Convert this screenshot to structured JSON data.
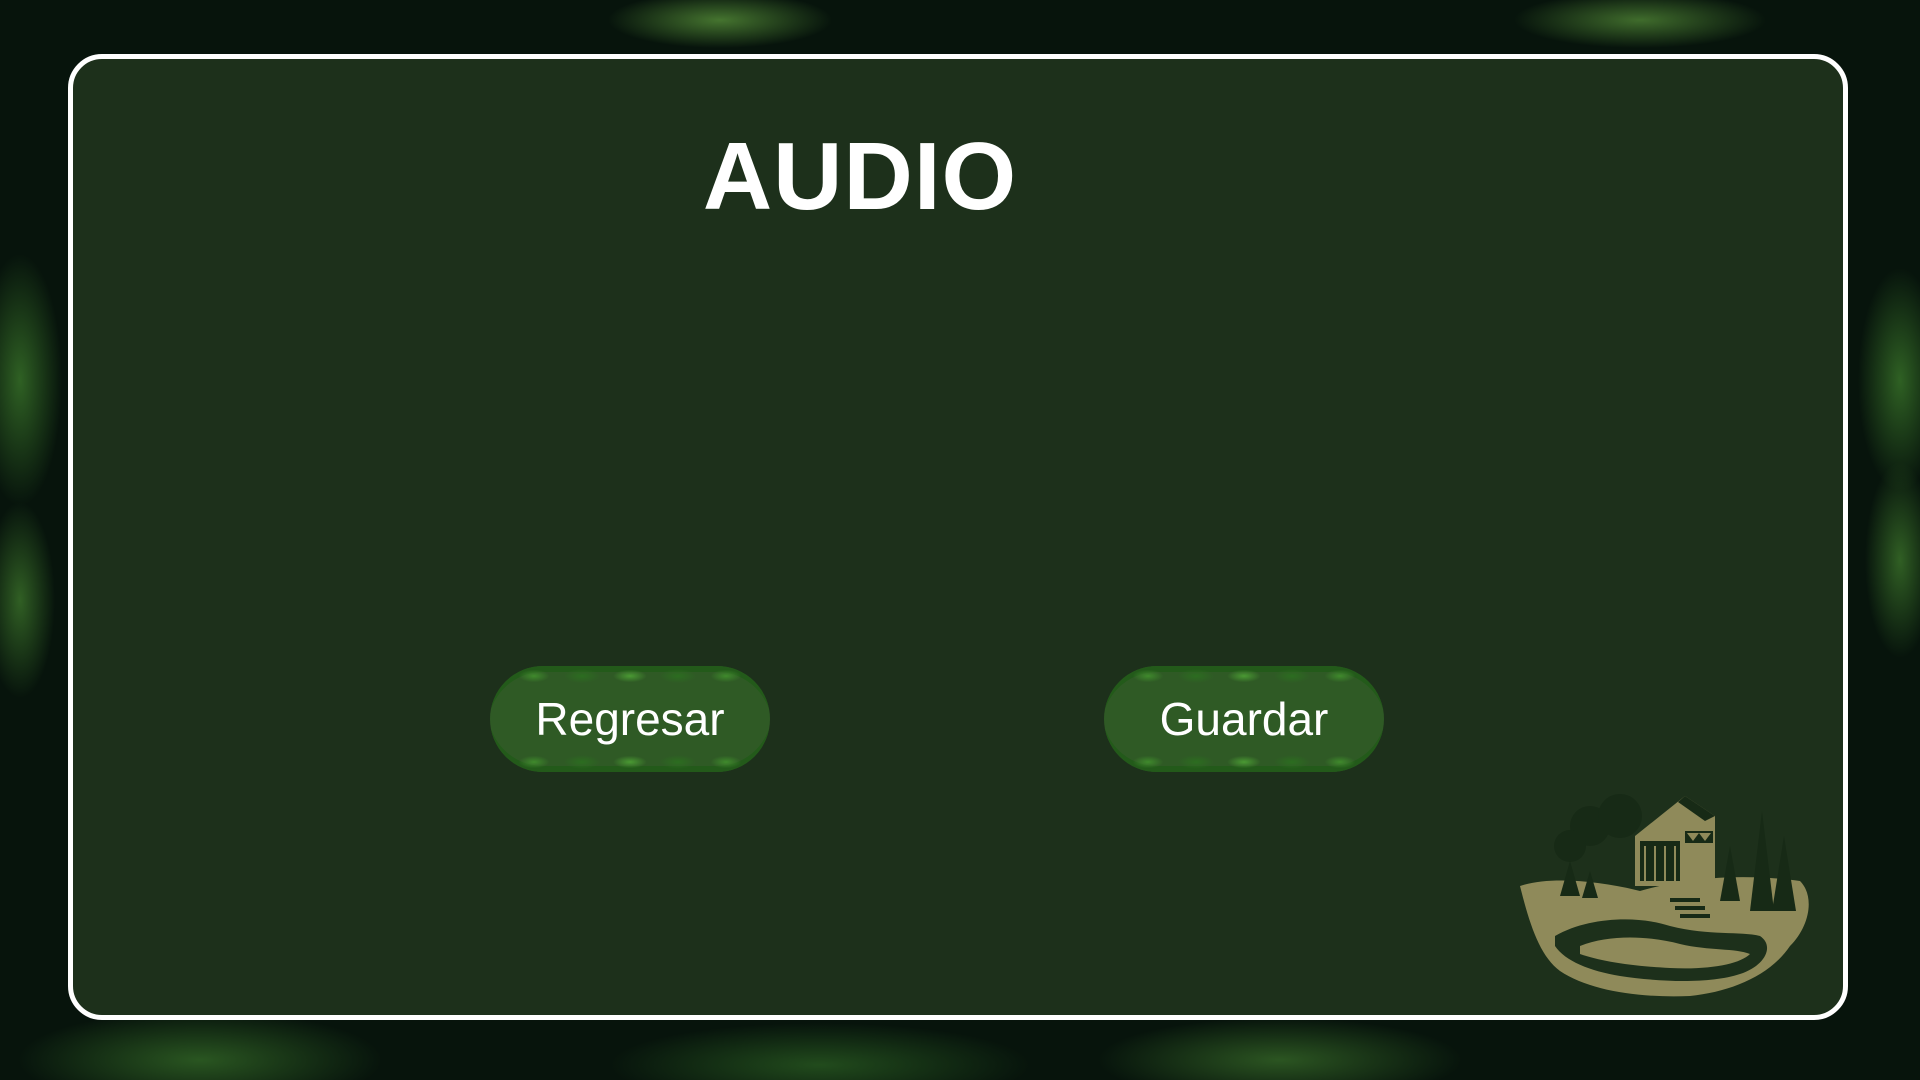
{
  "screen": {
    "title": "AUDIO"
  },
  "buttons": {
    "back_label": "Regresar",
    "save_label": "Guardar"
  },
  "decor": {
    "logo": "covered-bridge-forest-logo",
    "background": "pine-foliage"
  },
  "colors": {
    "panel": "#1d301b",
    "panel_border": "#ffffff",
    "button": "#2f5a25",
    "logo_tan": "#8f8a5a",
    "logo_dark": "#172a16"
  }
}
